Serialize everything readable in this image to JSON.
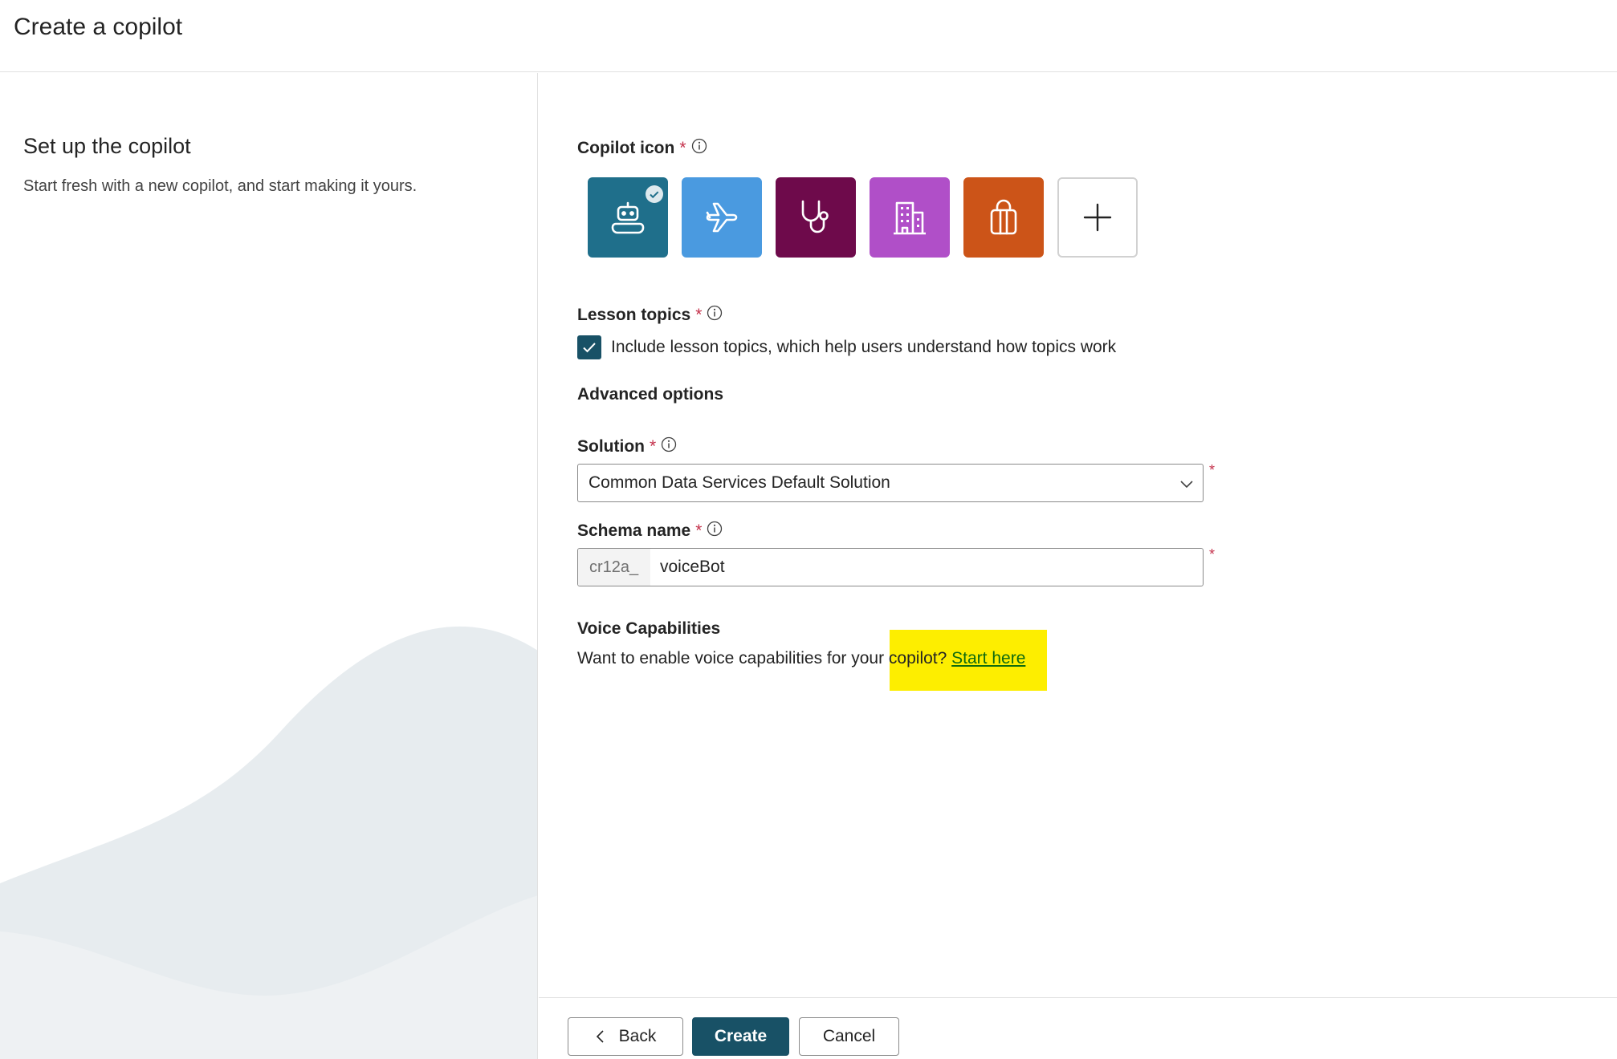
{
  "header": {
    "title": "Create a copilot"
  },
  "left": {
    "title": "Set up the copilot",
    "description": "Start fresh with a new copilot, and start making it yours."
  },
  "copilot_icon": {
    "label": "Copilot icon",
    "required_mark": "*",
    "options": [
      {
        "name": "robot-icon",
        "color": "#1f6f8b",
        "selected": true
      },
      {
        "name": "airplane-icon",
        "color": "#4a9ae0",
        "selected": false
      },
      {
        "name": "stethoscope-icon",
        "color": "#6e0a4b",
        "selected": false
      },
      {
        "name": "building-icon",
        "color": "#b04fc8",
        "selected": false
      },
      {
        "name": "gift-bag-icon",
        "color": "#cc5418",
        "selected": false
      },
      {
        "name": "add-icon",
        "color": "#ffffff",
        "selected": false
      }
    ]
  },
  "lesson_topics": {
    "label": "Lesson topics",
    "required_mark": "*",
    "checked": true,
    "checkbox_text": "Include lesson topics, which help users understand how topics work"
  },
  "advanced": {
    "label": "Advanced options"
  },
  "solution": {
    "label": "Solution",
    "required_mark": "*",
    "value": "Common Data Services Default Solution"
  },
  "schema": {
    "label": "Schema name",
    "required_mark": "*",
    "prefix": "cr12a_",
    "value": "voiceBot"
  },
  "voice": {
    "title": "Voice Capabilities",
    "text": "Want to enable voice capabilities for your copilot? ",
    "link": "Start here",
    "highlight_color": "#fdee00"
  },
  "footer": {
    "back_label": "Back",
    "create_label": "Create",
    "cancel_label": "Cancel"
  },
  "colors": {
    "primary": "#185166",
    "required": "#c4314b"
  }
}
